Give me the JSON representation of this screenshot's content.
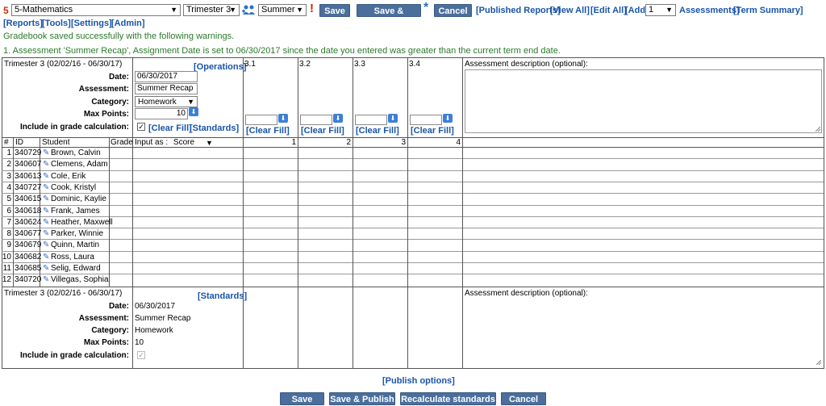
{
  "top_bar": {
    "course_number": "5",
    "course_select": "5-Mathematics",
    "term_select": "Trimester 3",
    "assessment_select": "Summer",
    "warning_mark": "!",
    "save_label": "Save",
    "save_publish_label": "Save & Publish",
    "asterisk": "*",
    "cancel_label": "Cancel",
    "published_reports": "[Published Reports]",
    "view_all": "[View All]",
    "edit_all": "[Edit All]",
    "add_label": "[Add",
    "add_count": "1",
    "assessments": "Assessments]",
    "term_summary": "[Term Summary]"
  },
  "menu": {
    "reports": "[Reports]",
    "tools": "[Tools]",
    "settings": "[Settings]",
    "admin": "[Admin]"
  },
  "messages": {
    "saved": "Gradebook saved successfully with the following warnings.",
    "warning": "1. Assessment 'Summer Recap', Assignment Date is set to 06/30/2017 since the date you entered was greater than the current term end date."
  },
  "editor": {
    "term_label": "Trimester 3 (02/02/16 - 06/30/17)",
    "operations": "[Operations]",
    "date_label": "Date:",
    "date_value": "06/30/2017",
    "assessment_label": "Assessment:",
    "assessment_value": "Summer Recap",
    "category_label": "Category:",
    "category_value": "Homework",
    "max_points_label": "Max Points:",
    "max_points_value": "10",
    "include_label": "Include in grade calculation:",
    "clear_fill": "[Clear Fill]",
    "standards": "[Standards]",
    "desc_label": "Assessment description (optional):"
  },
  "standards_columns": [
    {
      "header": "3.1",
      "clear": "[Clear Fill]",
      "num": "1"
    },
    {
      "header": "3.2",
      "clear": "[Clear Fill]",
      "num": "2"
    },
    {
      "header": "3.3",
      "clear": "[Clear Fill]",
      "num": "3"
    },
    {
      "header": "3.4",
      "clear": "[Clear Fill]",
      "num": "4"
    }
  ],
  "grid": {
    "col_num": "#",
    "col_id": "ID",
    "col_student": "Student",
    "col_grade": "Grade",
    "input_as_label": "Input as :",
    "input_as_value": "Score",
    "students": [
      {
        "n": "1",
        "id": "340729",
        "name": "Brown, Calvin"
      },
      {
        "n": "2",
        "id": "340607",
        "name": "Clemens, Adam"
      },
      {
        "n": "3",
        "id": "340613",
        "name": "Cole, Erik"
      },
      {
        "n": "4",
        "id": "340727",
        "name": "Cook, Kristyl"
      },
      {
        "n": "5",
        "id": "340615",
        "name": "Dominic, Kaylie"
      },
      {
        "n": "6",
        "id": "340618",
        "name": "Frank, James"
      },
      {
        "n": "7",
        "id": "340624",
        "name": "Heather, Maxwell"
      },
      {
        "n": "8",
        "id": "340677",
        "name": "Parker, Winnie"
      },
      {
        "n": "9",
        "id": "340679",
        "name": "Quinn, Martin"
      },
      {
        "n": "10",
        "id": "340682",
        "name": "Ross, Laura"
      },
      {
        "n": "11",
        "id": "340685",
        "name": "Selig, Edward"
      },
      {
        "n": "12",
        "id": "340720",
        "name": "Villegas, Sophia"
      }
    ]
  },
  "summary": {
    "term_label": "Trimester 3 (02/02/16 - 06/30/17)",
    "standards": "[Standards]",
    "date_label": "Date:",
    "date_value": "06/30/2017",
    "assessment_label": "Assessment:",
    "assessment_value": "Summer Recap",
    "category_label": "Category:",
    "category_value": "Homework",
    "max_points_label": "Max Points:",
    "max_points_value": "10",
    "include_label": "Include in grade calculation:",
    "desc_label": "Assessment description (optional):"
  },
  "footer": {
    "publish_options": "[Publish options]",
    "save": "Save",
    "save_publish": "Save & Publish",
    "recalculate": "Recalculate standards",
    "cancel": "Cancel"
  },
  "colors": {
    "button": "#4a6f9c",
    "link": "#1a55a8",
    "success": "#2a7a2a",
    "warning": "#cc2200"
  }
}
